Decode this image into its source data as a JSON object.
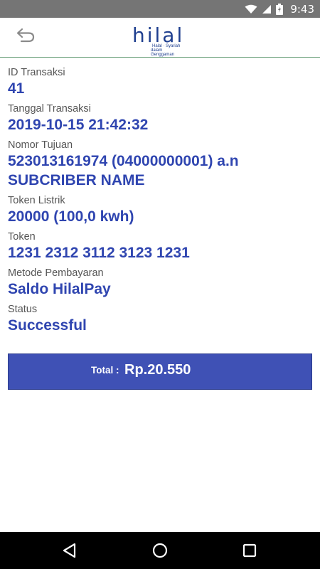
{
  "status_bar": {
    "time": "9:43"
  },
  "app_bar": {
    "logo": {
      "word": "hilal",
      "tagline_line1": "Halal · Syariah",
      "tagline_line2": "dalam Genggaman"
    },
    "back_icon": "undo-arrow-icon"
  },
  "transaction": {
    "fields": [
      {
        "label": "ID Transaksi",
        "value": "41"
      },
      {
        "label": "Tanggal Transaksi",
        "value": "2019-10-15 21:42:32"
      },
      {
        "label": "Nomor Tujuan",
        "value": "523013161974 (04000000001) a.n SUBCRIBER NAME"
      },
      {
        "label": "Token Listrik",
        "value": "20000 (100,0 kwh)"
      },
      {
        "label": "Token",
        "value": "1231 2312 3112 3123 1231"
      },
      {
        "label": "Metode Pembayaran",
        "value": "Saldo HilalPay"
      },
      {
        "label": "Status",
        "value": "Successful"
      }
    ]
  },
  "total": {
    "label": "Total :",
    "amount": "Rp.20.550"
  },
  "colors": {
    "accent": "#3f51b5",
    "value_text": "#2f45b0",
    "status_bar": "#757575",
    "nav_bar": "#000000"
  },
  "nav_bar": {
    "back": "triangle-back-icon",
    "home": "circle-home-icon",
    "recents": "square-recents-icon"
  }
}
